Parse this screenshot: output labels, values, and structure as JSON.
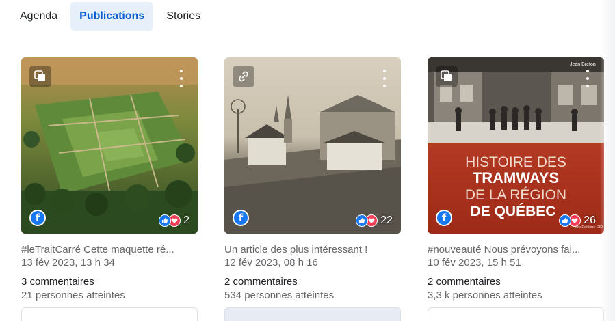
{
  "tabs": [
    {
      "label": "Agenda",
      "active": false
    },
    {
      "label": "Publications",
      "active": true
    },
    {
      "label": "Stories",
      "active": false
    }
  ],
  "posts": [
    {
      "type_icon": "album-icon",
      "platform_icon": "facebook-icon",
      "reactions": "2",
      "caption": "#leTraitCarré Cette maquette ré...",
      "date": "13 fév 2023, 13 h 34",
      "comments": "3 commentaires",
      "reach": "21 personnes atteintes"
    },
    {
      "type_icon": "link-icon",
      "platform_icon": "facebook-icon",
      "reactions": "22",
      "caption": "Un article des plus intéressant !",
      "date": "12 fév 2023, 08 h 16",
      "comments": "2 commentaires",
      "reach": "534 personnes atteintes"
    },
    {
      "type_icon": "album-icon",
      "platform_icon": "facebook-icon",
      "reactions": "26",
      "caption": "#nouveauté Nous prévoyons fai...",
      "date": "10 fév 2023, 15 h 51",
      "comments": "2 commentaires",
      "reach": "3,3 k personnes atteintes",
      "cover": {
        "author": "Jean Breton",
        "title_lines": [
          "HISTOIRE DES",
          "TRAMWAYS",
          "DE LA RÉGION",
          "DE QUÉBEC"
        ],
        "publisher": "Les Éditions GID"
      }
    }
  ],
  "colors": {
    "accent": "#0a5ad1",
    "active_tab_bg": "#e7f0fa",
    "facebook": "#1877f2",
    "love": "#f33e58"
  }
}
